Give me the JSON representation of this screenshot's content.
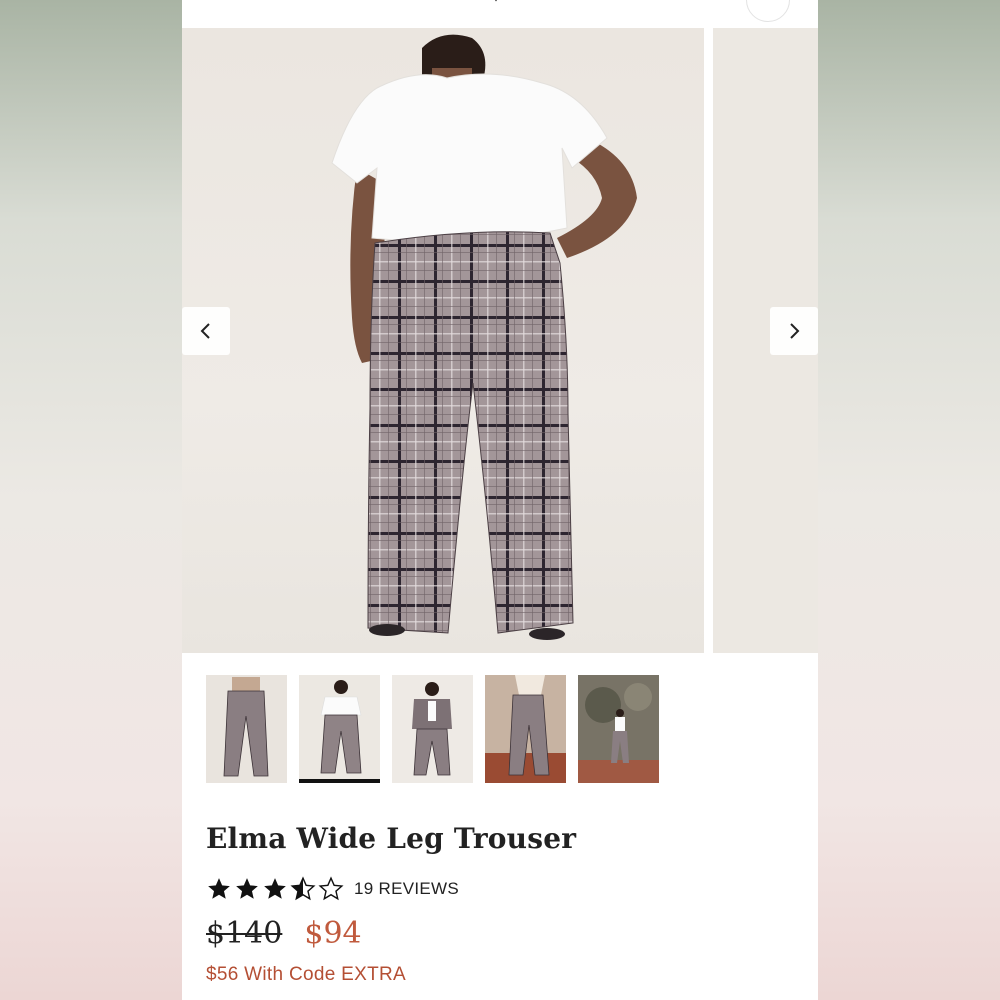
{
  "product": {
    "title": "Elma Wide Leg Trouser",
    "rating_value": 3.5,
    "rating_max": 5,
    "reviews_label": "19 REVIEWS",
    "original_price": "$140",
    "sale_price": "$94",
    "promo_text": "$56 With Code EXTRA"
  },
  "gallery": {
    "prev_icon": "chevron-left-icon",
    "next_icon": "chevron-right-icon",
    "active_thumbnail": 2,
    "thumbnail_count": 5
  },
  "colors": {
    "sale": "#c05a3d",
    "promo": "#b44f34",
    "text": "#222222"
  }
}
